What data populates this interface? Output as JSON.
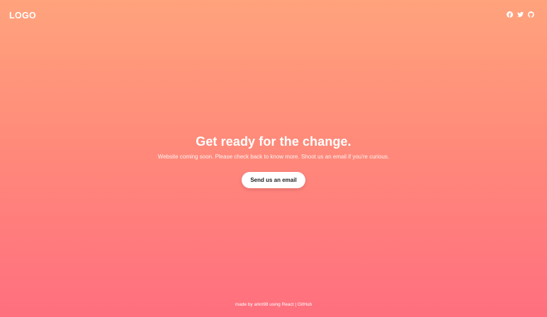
{
  "header": {
    "logo_text": "LOGO",
    "social_icons": [
      "facebook-icon",
      "twitter-icon",
      "github-icon"
    ]
  },
  "hero": {
    "title": "Get ready for the change.",
    "subtitle": "Website coming soon. Please check back to know more. Shoot us an email if you're curious.",
    "cta_label": "Send us an email"
  },
  "footer": {
    "made_by_text": "made by arkn98 using React",
    "separator": "|",
    "github_label": "GitHub"
  },
  "colors": {
    "gradient_top": "#ffa37c",
    "gradient_bottom": "#ff6f7f",
    "button_bg": "#ffffff",
    "button_text": "#1f1f1f"
  }
}
